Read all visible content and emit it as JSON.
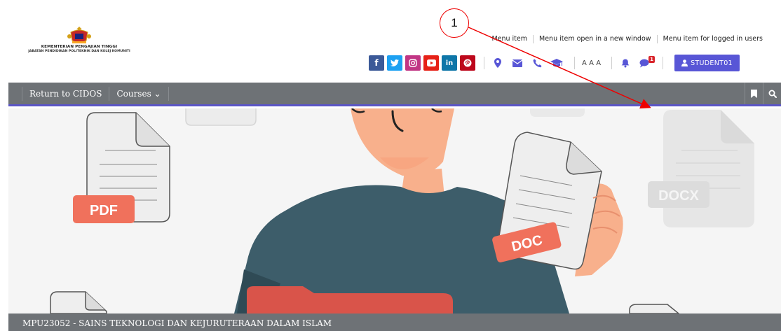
{
  "logo": {
    "line1": "KEMENTERIAN PENGAJIAN TINGGI",
    "line2": "JABATAN PENDIDIKAN POLITEKNIK DAN KOLEJ KOMUNITI"
  },
  "top_menu": [
    {
      "label": "Menu item"
    },
    {
      "label": "Menu item open in a new window"
    },
    {
      "label": "Menu item for logged in users"
    }
  ],
  "social": [
    {
      "icon": "facebook-icon",
      "glyph": "f",
      "color": "#3b5998"
    },
    {
      "icon": "twitter-icon",
      "glyph": "",
      "color": "#1da1f2"
    },
    {
      "icon": "instagram-icon",
      "glyph": "",
      "color": "#c13584"
    },
    {
      "icon": "youtube-icon",
      "glyph": "",
      "color": "#e62117"
    },
    {
      "icon": "linkedin-icon",
      "glyph": "in",
      "color": "#0e76a8"
    },
    {
      "icon": "pinterest-icon",
      "glyph": "",
      "color": "#bd081c"
    }
  ],
  "contact_icons": [
    "map-marker-icon",
    "envelope-icon",
    "phone-icon",
    "graduation-cap-icon"
  ],
  "font_size_label": "AAA",
  "notifications": {
    "count": "1"
  },
  "user": {
    "label": "STUDENT01"
  },
  "annotation": {
    "label": "1"
  },
  "nav": {
    "items": [
      {
        "label": "Return to CIDOS"
      },
      {
        "label": "Courses ⌄"
      }
    ]
  },
  "hero_labels": {
    "pdf": "PDF",
    "doc": "DOC",
    "docx": "DOCX"
  },
  "course": {
    "title": "MPU23052 - SAINS TEKNOLOGI DAN KEJURUTERAAN DALAM ISLAM"
  },
  "colors": {
    "accent": "#5856d6",
    "nav_bg": "#6e7276",
    "nav_border": "#5b55c6",
    "annotation": "#e00000"
  }
}
